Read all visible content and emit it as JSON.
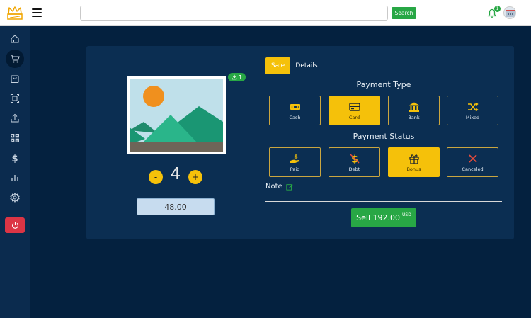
{
  "header": {
    "search": {
      "value": "",
      "placeholder": ""
    },
    "search_button": "Search",
    "notification_count": "1"
  },
  "product": {
    "stock_badge": "1",
    "quantity": "4",
    "minus_label": "-",
    "plus_label": "+",
    "unit_price": "48.00"
  },
  "tabs": [
    {
      "label": "Sale",
      "active": true
    },
    {
      "label": "Details",
      "active": false
    }
  ],
  "payment_type": {
    "title": "Payment Type",
    "options": [
      {
        "label": "Cash",
        "icon": "cash-icon",
        "selected": false
      },
      {
        "label": "Card",
        "icon": "credit-card-icon",
        "selected": true
      },
      {
        "label": "Bank",
        "icon": "bank-icon",
        "selected": false
      },
      {
        "label": "Mixed",
        "icon": "shuffle-icon",
        "selected": false
      }
    ]
  },
  "payment_status": {
    "title": "Payment Status",
    "options": [
      {
        "label": "Paid",
        "icon": "hand-dollar-icon",
        "selected": false
      },
      {
        "label": "Debt",
        "icon": "dollar-crossed-icon",
        "selected": false
      },
      {
        "label": "Bonus",
        "icon": "gift-icon",
        "selected": true
      },
      {
        "label": "Canceled",
        "icon": "x-icon",
        "selected": false
      }
    ]
  },
  "note": {
    "label": "Note"
  },
  "sell": {
    "label": "Sell 192.00",
    "currency": "USD"
  },
  "colors": {
    "accent": "#f5c10a",
    "success": "#28a745",
    "danger": "#dc3545",
    "card_bg": "#0b2e52",
    "page_bg": "#04213f"
  }
}
